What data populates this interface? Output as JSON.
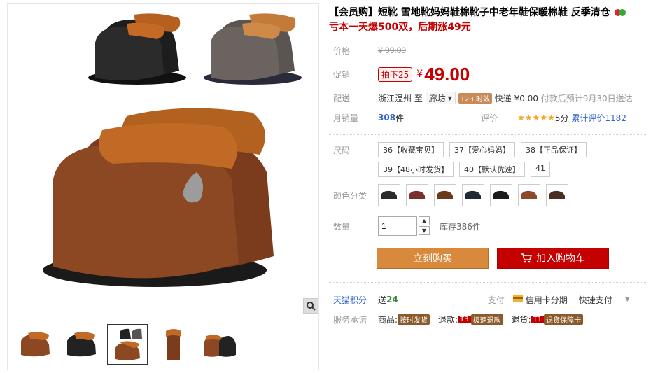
{
  "product": {
    "title": "【会员购】短靴 雪地靴妈妈鞋棉靴子中老年鞋保暖棉鞋 反季清仓",
    "subtitle": "亏本一天爆500双，后期涨49元"
  },
  "price": {
    "label": "价格",
    "currency": "¥",
    "original": "99.00"
  },
  "promo": {
    "label": "促销",
    "tag": "拍下25",
    "currency": "¥",
    "price": "49.00"
  },
  "delivery": {
    "label": "配送",
    "from": "浙江温州",
    "to_label": "至",
    "to": "廊坊",
    "timing_badge": "123 时效",
    "shipping": "快递 ¥0.00",
    "eta": "付款后预计9月30日送达"
  },
  "sales": {
    "label": "月销量",
    "count": "308",
    "unit": "件",
    "review_label": "评价",
    "stars": "★★★★★",
    "score": "5分",
    "reviews_link": "累计评价1182"
  },
  "sizes": {
    "label": "尺码",
    "options": [
      "36【收藏宝贝】",
      "37【爱心妈妈】",
      "38【正品保证】",
      "39【48小时发货】",
      "40【默认优速】",
      "41"
    ]
  },
  "colors": {
    "label": "颜色分类",
    "swatches": [
      "#2a2a2a",
      "#7a2e2e",
      "#6b3a1e",
      "#1e2a3a",
      "#1a1a1a",
      "#8b4a2a",
      "#4a2e24"
    ]
  },
  "quantity": {
    "label": "数量",
    "value": "1",
    "stock": "库存386件"
  },
  "actions": {
    "buy_now": "立刻购买",
    "add_to_cart": "加入购物车"
  },
  "extras": {
    "points_label": "天猫积分",
    "points_prefix": "送",
    "points_value": "24",
    "pay_label": "支付",
    "pay_option": "信用卡分期",
    "pay_fast": "快捷支付",
    "service_label": "服务承诺",
    "goods_prefix": "商品:",
    "goods_badge": "按时发货",
    "refund_prefix": "退款:",
    "refund_code": "T3",
    "refund_badge": "极速退款",
    "return_prefix": "退货:",
    "return_code": "T1",
    "return_badge": "退货保障卡"
  },
  "icons": {
    "zoom": "magnifier-icon",
    "cart": "cart-icon",
    "card": "credit-card-icon",
    "gift": "gift-icon"
  }
}
